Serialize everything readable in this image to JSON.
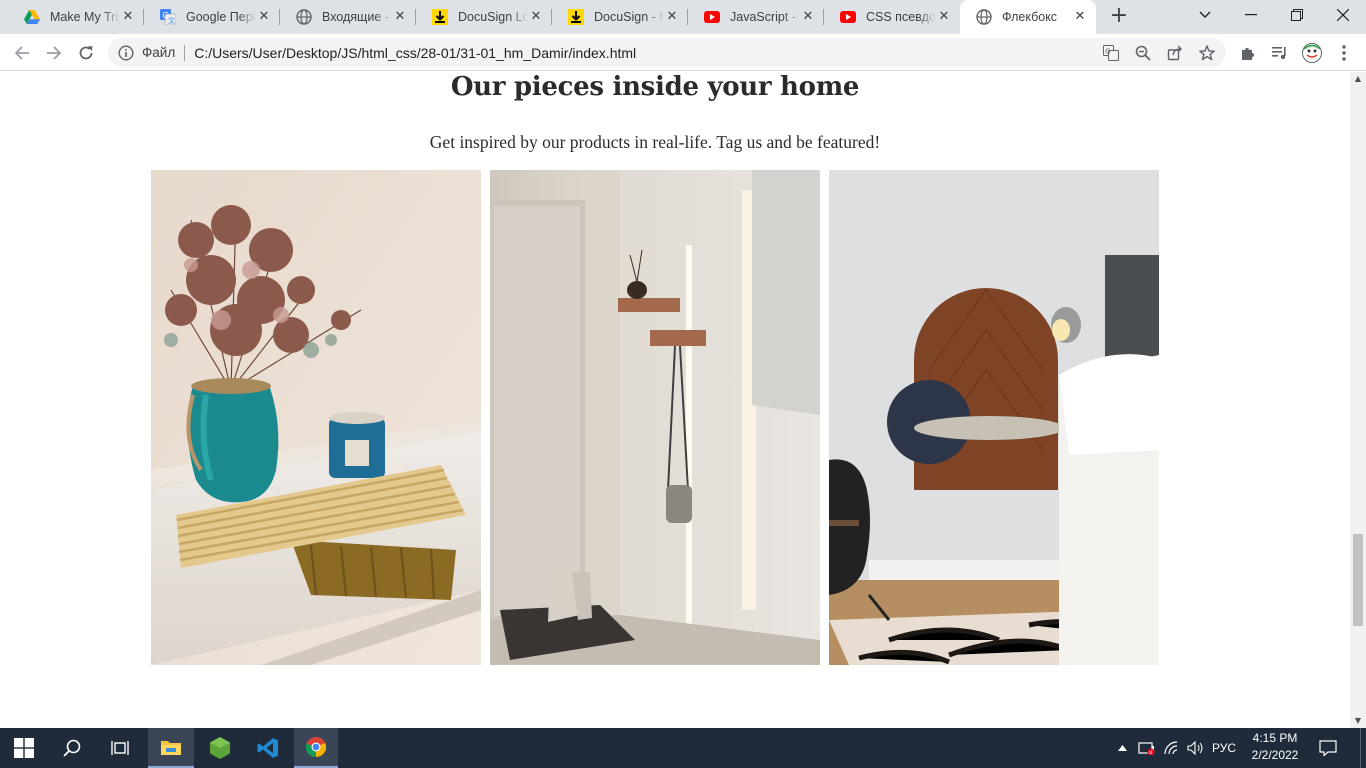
{
  "browser": {
    "tabs": [
      {
        "title": "Make My Trip",
        "icon": "google-drive-icon"
      },
      {
        "title": "Google Переводчик",
        "icon": "google-translate-icon"
      },
      {
        "title": "Входящие - почта",
        "icon": "globe-icon"
      },
      {
        "title": "DocuSign Login",
        "icon": "docusign-icon"
      },
      {
        "title": "DocuSign - Manage",
        "icon": "docusign-icon"
      },
      {
        "title": "JavaScript - Полный курс",
        "icon": "youtube-icon"
      },
      {
        "title": "CSS псевдоклассы",
        "icon": "youtube-icon"
      },
      {
        "title": "Флекбокс",
        "icon": "globe-icon",
        "active": true
      }
    ],
    "omnibox": {
      "scheme_label": "Файл",
      "url": "C:/Users/User/Desktop/JS/html_css/28-01/31-01_hm_Damir/index.html"
    }
  },
  "page": {
    "heading": "Our pieces inside your home",
    "subheading": "Get inspired by our products in real-life. Tag us and be featured!",
    "photos": [
      {
        "subject": "dried flowers in teal vase with ribbed wooden tray on white dresser"
      },
      {
        "subject": "hallway with wooden wall shelves, hanging bag and boots"
      },
      {
        "subject": "walnut arch headboard shelf with lamp, guitar and bed"
      }
    ]
  },
  "taskbar": {
    "language": "РУС",
    "time": "4:15 PM",
    "date": "2/2/2022"
  },
  "colors": {
    "tabstrip": "#dee1e6",
    "taskbar": "#1f2a3a",
    "text": "#2b2b2b"
  }
}
